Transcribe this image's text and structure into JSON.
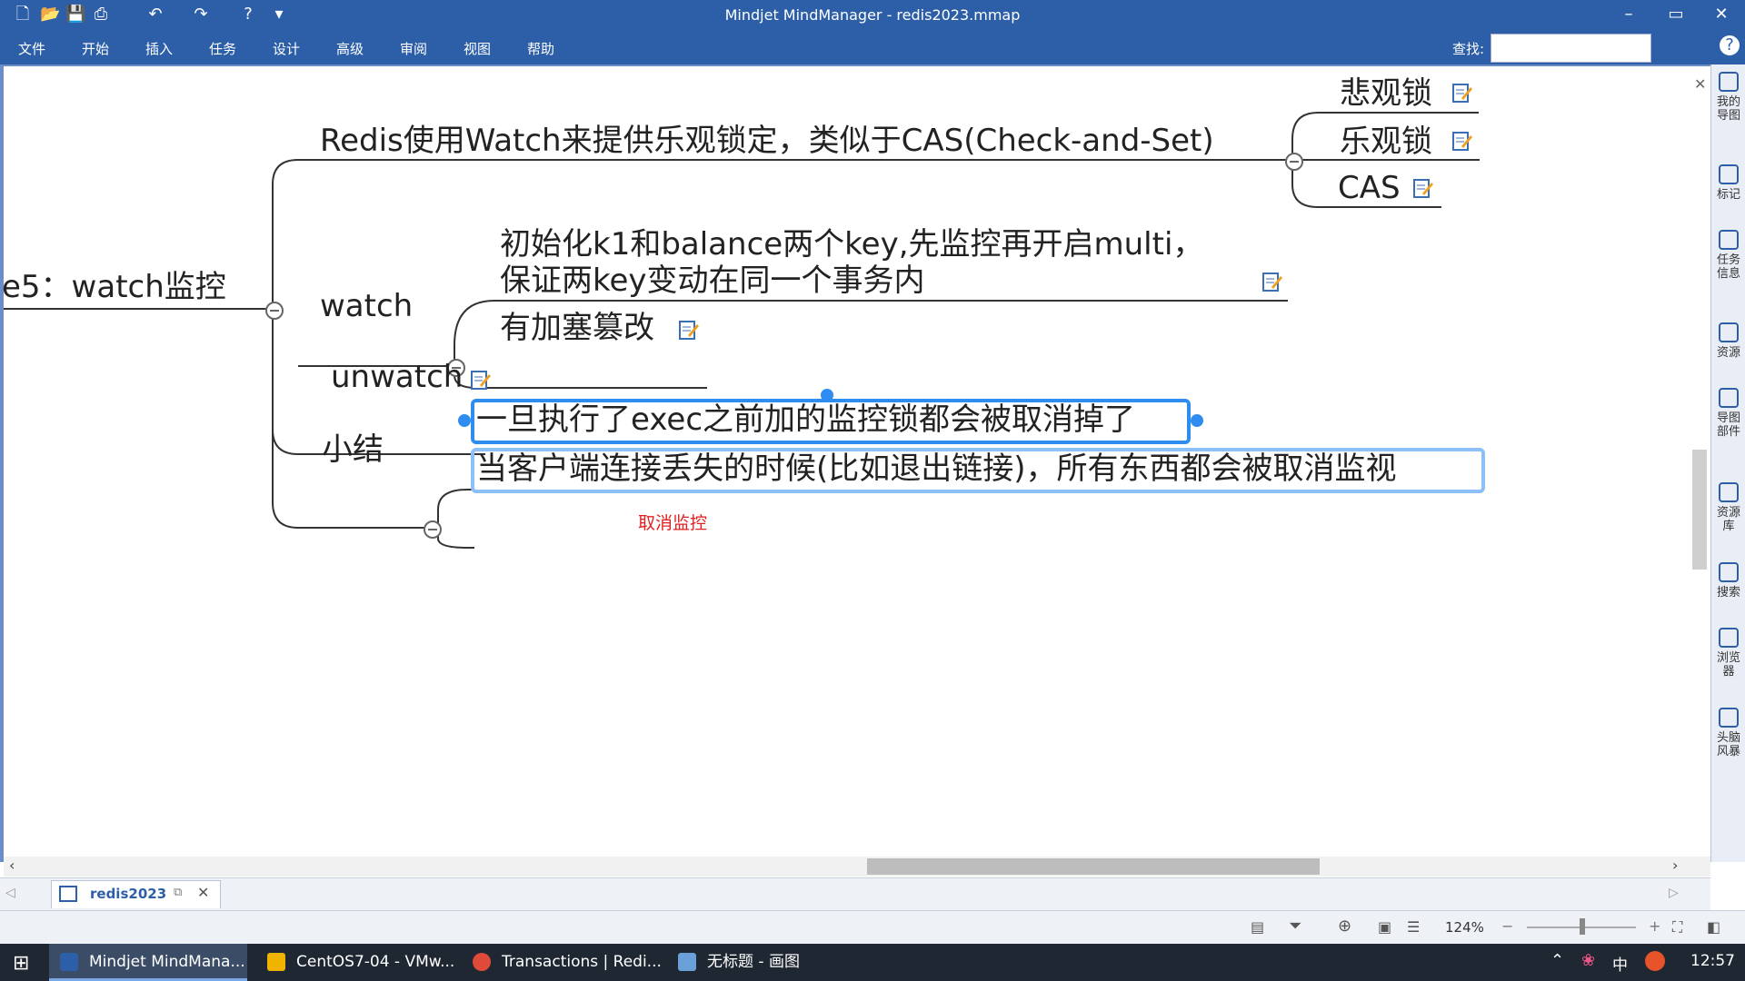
{
  "window": {
    "title": "Mindjet MindManager - redis2023.mmap",
    "controls": [
      "–",
      "▭",
      "✕"
    ]
  },
  "menu": {
    "items": [
      "文件",
      "开始",
      "插入",
      "任务",
      "设计",
      "高级",
      "审阅",
      "视图",
      "帮助"
    ],
    "search_label": "查找:"
  },
  "map": {
    "central_topic": "e5：watch监控",
    "branches": {
      "redis_watch": "Redis使用Watch来提供乐观锁定，类似于CAS(Check-and-Set)",
      "pessimistic": "悲观锁",
      "optimistic": "乐观锁",
      "cas": "CAS",
      "watch": "watch",
      "watch_init_line1": "初始化k1和balance两个key,先监控再开启multi，",
      "watch_init_line2": "保证两key变动在同一个事务内",
      "tamper": "有加塞篡改",
      "unwatch": "unwatch",
      "summary": "小结",
      "summary_exec": "一旦执行了exec之前加的监控锁都会被取消掉了",
      "summary_disconnect": "当客户端连接丢失的时候(比如退出链接)，所有东西都会被取消监视",
      "cancel_note": "取消监控"
    }
  },
  "right_panel": {
    "items": [
      "我的导图",
      "标记",
      "任务信息",
      "资源",
      "导图部件",
      "资源库",
      "搜索",
      "浏览器",
      "头脑风暴"
    ]
  },
  "tabs": {
    "doc_tab": "redis2023"
  },
  "status": {
    "zoom": "124%"
  },
  "taskbar": {
    "apps": [
      "Mindjet MindMana...",
      "CentOS7-04 - VMw...",
      "Transactions | Redi...",
      "无标题 - 画图"
    ],
    "ime": "中",
    "clock": "12:57"
  },
  "colors": {
    "titlebar": "#2d5fa8",
    "selection": "#2f8cf0",
    "note_red": "#e02020",
    "taskbar": "#1f2733"
  }
}
